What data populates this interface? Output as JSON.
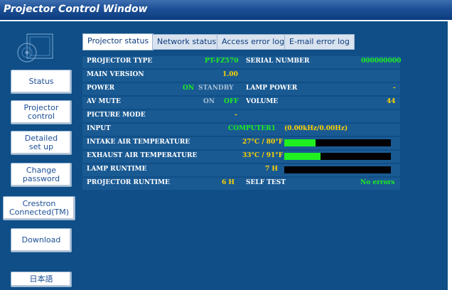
{
  "window": {
    "title": "Projector Control Window"
  },
  "sidebar": {
    "buttons": [
      {
        "label": "Status"
      },
      {
        "label": "Projector\ncontrol"
      },
      {
        "label": "Detailed\nset up"
      },
      {
        "label": "Change\npassword"
      },
      {
        "label": "Crestron\nConnected(TM)"
      },
      {
        "label": "Download"
      }
    ],
    "language": "日本語"
  },
  "tabs": [
    {
      "label": "Projector status",
      "active": true
    },
    {
      "label": "Network status"
    },
    {
      "label": "Access error log"
    },
    {
      "label": "E-mail error log"
    }
  ],
  "status": {
    "projector_type": {
      "label": "PROJECTOR TYPE",
      "value": "PT-FZ570"
    },
    "serial_number": {
      "label": "SERIAL NUMBER",
      "value": "000000000"
    },
    "main_version": {
      "label": "MAIN VERSION",
      "value": "1.00"
    },
    "power": {
      "label": "POWER",
      "on": "ON",
      "standby": "STANDBY"
    },
    "lamp_power": {
      "label": "LAMP POWER",
      "value": "-"
    },
    "av_mute": {
      "label": "AV MUTE",
      "on": "ON",
      "off": "OFF"
    },
    "volume": {
      "label": "VOLUME",
      "value": "44"
    },
    "picture_mode": {
      "label": "PICTURE MODE",
      "value": "-"
    },
    "input": {
      "label": "INPUT",
      "value": "COMPUTER1",
      "freq": "(0.00kHz/0.00Hz)"
    },
    "intake_air": {
      "label": "INTAKE AIR TEMPERATURE",
      "value": "27°C / 80°F",
      "level": 0.29
    },
    "exhaust_air": {
      "label": "EXHAUST AIR TEMPERATURE",
      "value": "33°C / 91°F",
      "level": 0.34
    },
    "lamp_runtime": {
      "label": "LAMP RUNTIME",
      "value": "7 H",
      "level": 0.0
    },
    "projector_runtime": {
      "label": "PROJECTOR RUNTIME",
      "value": "6 H"
    },
    "self_test": {
      "label": "SELF TEST",
      "value": "No errors"
    }
  }
}
